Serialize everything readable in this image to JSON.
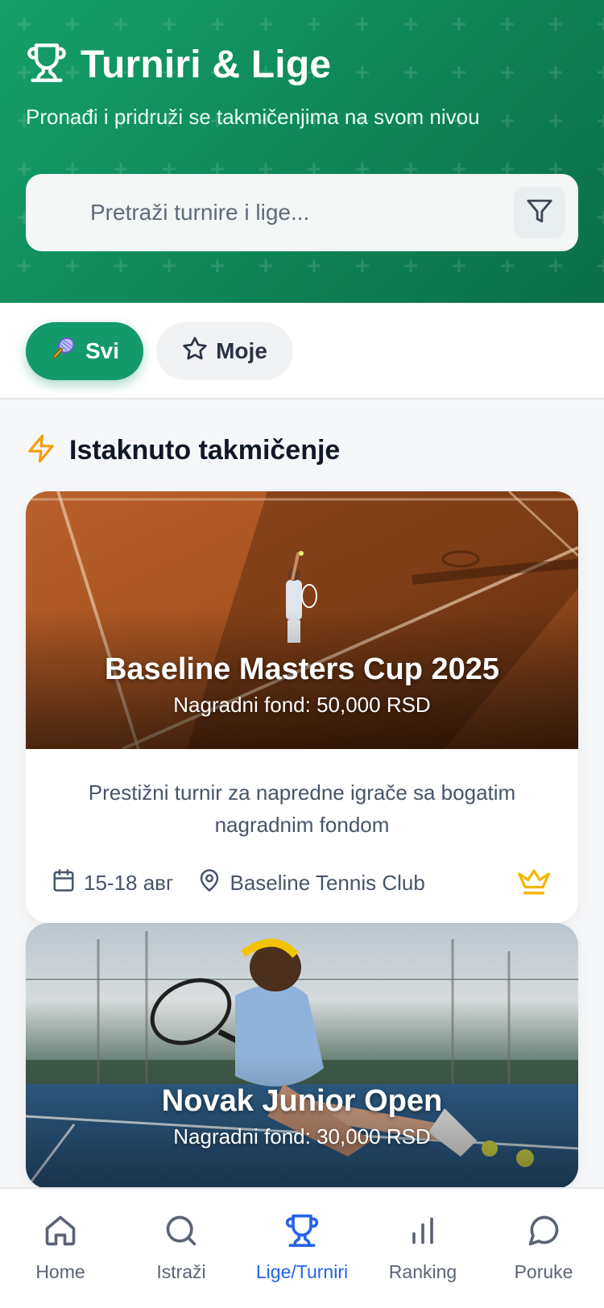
{
  "header": {
    "title": "Turniri & Lige",
    "subtitle": "Pronađi i pridruži se takmičenjima na svom nivou",
    "search_placeholder": "Pretraži turnire i lige...",
    "icons": {
      "title": "trophy-icon",
      "filter": "filter-icon"
    }
  },
  "tabs": [
    {
      "label": "Svi",
      "icon": "tennis-racket-icon",
      "active": true
    },
    {
      "label": "Moje",
      "icon": "star-icon",
      "active": false
    }
  ],
  "featured": {
    "section_title": "Istaknuto takmičenje",
    "icon": "lightning-icon",
    "cards": [
      {
        "title": "Baseline Masters Cup 2025",
        "prize": "Nagradni fond: 50,000 RSD",
        "description": "Prestižni turnir za napredne igrače sa bogatim nagradnim fondom",
        "date": "15-18 авг",
        "location": "Baseline Tennis Club",
        "badge_icon": "crown-icon"
      },
      {
        "title": "Novak Junior Open",
        "prize": "Nagradni fond: 30,000 RSD"
      }
    ]
  },
  "bottom_nav": [
    {
      "label": "Home",
      "icon": "home-icon",
      "active": false
    },
    {
      "label": "Istraži",
      "icon": "search-icon",
      "active": false
    },
    {
      "label": "Lige/Turniri",
      "icon": "trophy-icon",
      "active": true
    },
    {
      "label": "Ranking",
      "icon": "bar-chart-icon",
      "active": false
    },
    {
      "label": "Poruke",
      "icon": "chat-bubble-icon",
      "active": false
    }
  ],
  "colors": {
    "brand_green": "#14996a",
    "active_nav": "#2563eb",
    "crown": "#f2b705",
    "accent_amber": "#f59e0b"
  }
}
